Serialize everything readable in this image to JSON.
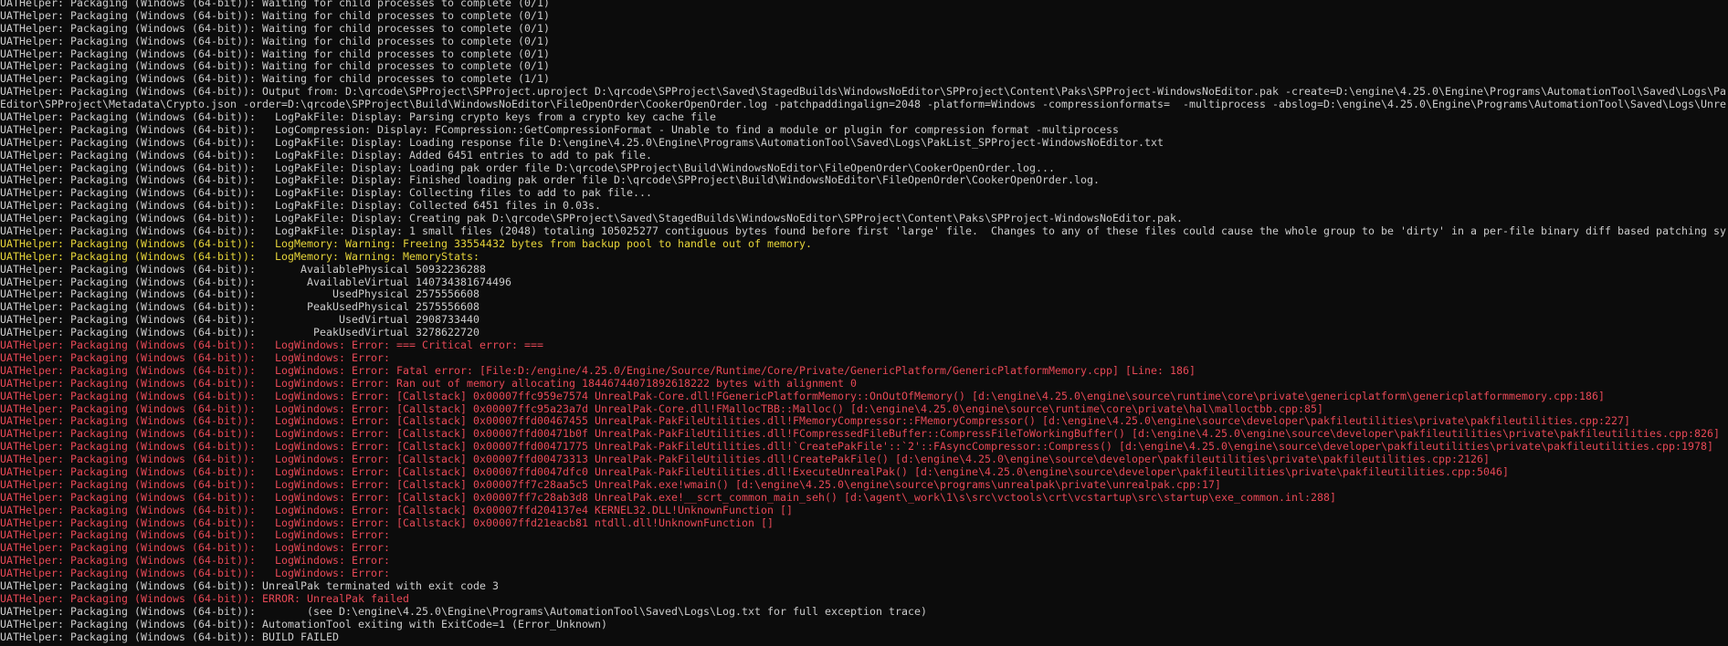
{
  "console": {
    "colors": {
      "background": "#0c0c0c",
      "normal": "#cccccc",
      "warning": "#e6d43a",
      "error": "#e74856"
    },
    "lines": [
      {
        "level": "normal",
        "text": "UATHelper: Packaging (Windows (64-bit)): Waiting for child processes to complete (0/1)"
      },
      {
        "level": "normal",
        "text": "UATHelper: Packaging (Windows (64-bit)): Waiting for child processes to complete (0/1)"
      },
      {
        "level": "normal",
        "text": "UATHelper: Packaging (Windows (64-bit)): Waiting for child processes to complete (0/1)"
      },
      {
        "level": "normal",
        "text": "UATHelper: Packaging (Windows (64-bit)): Waiting for child processes to complete (0/1)"
      },
      {
        "level": "normal",
        "text": "UATHelper: Packaging (Windows (64-bit)): Waiting for child processes to complete (0/1)"
      },
      {
        "level": "normal",
        "text": "UATHelper: Packaging (Windows (64-bit)): Waiting for child processes to complete (0/1)"
      },
      {
        "level": "normal",
        "text": "UATHelper: Packaging (Windows (64-bit)): Waiting for child processes to complete (1/1)"
      },
      {
        "level": "normal",
        "text": "UATHelper: Packaging (Windows (64-bit)): Output from: D:\\qrcode\\SPProject\\SPProject.uproject D:\\qrcode\\SPProject\\Saved\\StagedBuilds\\WindowsNoEditor\\SPProject\\Content\\Paks\\SPProject-WindowsNoEditor.pak -create=D:\\engine\\4.25.0\\Engine\\Programs\\AutomationTool\\Saved\\Logs\\Pa"
      },
      {
        "level": "normal",
        "text": "Editor\\SPProject\\Metadata\\Crypto.json -order=D:\\qrcode\\SPProject\\Build\\WindowsNoEditor\\FileOpenOrder\\CookerOpenOrder.log -patchpaddingalign=2048 -platform=Windows -compressionformats=  -multiprocess -abslog=D:\\engine\\4.25.0\\Engine\\Programs\\AutomationTool\\Saved\\Logs\\Unre"
      },
      {
        "level": "normal",
        "text": "UATHelper: Packaging (Windows (64-bit)):   LogPakFile: Display: Parsing crypto keys from a crypto key cache file"
      },
      {
        "level": "normal",
        "text": "UATHelper: Packaging (Windows (64-bit)):   LogCompression: Display: FCompression::GetCompressionFormat - Unable to find a module or plugin for compression format -multiprocess"
      },
      {
        "level": "normal",
        "text": "UATHelper: Packaging (Windows (64-bit)):   LogPakFile: Display: Loading response file D:\\engine\\4.25.0\\Engine\\Programs\\AutomationTool\\Saved\\Logs\\PakList_SPProject-WindowsNoEditor.txt"
      },
      {
        "level": "normal",
        "text": "UATHelper: Packaging (Windows (64-bit)):   LogPakFile: Display: Added 6451 entries to add to pak file."
      },
      {
        "level": "normal",
        "text": "UATHelper: Packaging (Windows (64-bit)):   LogPakFile: Display: Loading pak order file D:\\qrcode\\SPProject\\Build\\WindowsNoEditor\\FileOpenOrder\\CookerOpenOrder.log..."
      },
      {
        "level": "normal",
        "text": "UATHelper: Packaging (Windows (64-bit)):   LogPakFile: Display: Finished loading pak order file D:\\qrcode\\SPProject\\Build\\WindowsNoEditor\\FileOpenOrder\\CookerOpenOrder.log."
      },
      {
        "level": "normal",
        "text": "UATHelper: Packaging (Windows (64-bit)):   LogPakFile: Display: Collecting files to add to pak file..."
      },
      {
        "level": "normal",
        "text": "UATHelper: Packaging (Windows (64-bit)):   LogPakFile: Display: Collected 6451 files in 0.03s."
      },
      {
        "level": "normal",
        "text": "UATHelper: Packaging (Windows (64-bit)):   LogPakFile: Display: Creating pak D:\\qrcode\\SPProject\\Saved\\StagedBuilds\\WindowsNoEditor\\SPProject\\Content\\Paks\\SPProject-WindowsNoEditor.pak."
      },
      {
        "level": "normal",
        "text": "UATHelper: Packaging (Windows (64-bit)):   LogPakFile: Display: 1 small files (2048) totaling 105025277 contiguous bytes found before first 'large' file.  Changes to any of these files could cause the whole group to be 'dirty' in a per-file binary diff based patching sy"
      },
      {
        "level": "warning",
        "text": "UATHelper: Packaging (Windows (64-bit)):   LogMemory: Warning: Freeing 33554432 bytes from backup pool to handle out of memory."
      },
      {
        "level": "warning",
        "text": "UATHelper: Packaging (Windows (64-bit)):   LogMemory: Warning: MemoryStats:"
      },
      {
        "level": "normal",
        "text": "UATHelper: Packaging (Windows (64-bit)):       AvailablePhysical 50932236288"
      },
      {
        "level": "normal",
        "text": "UATHelper: Packaging (Windows (64-bit)):        AvailableVirtual 140734381674496"
      },
      {
        "level": "normal",
        "text": "UATHelper: Packaging (Windows (64-bit)):            UsedPhysical 2575556608"
      },
      {
        "level": "normal",
        "text": "UATHelper: Packaging (Windows (64-bit)):        PeakUsedPhysical 2575556608"
      },
      {
        "level": "normal",
        "text": "UATHelper: Packaging (Windows (64-bit)):             UsedVirtual 2908733440"
      },
      {
        "level": "normal",
        "text": "UATHelper: Packaging (Windows (64-bit)):         PeakUsedVirtual 3278622720"
      },
      {
        "level": "error",
        "text": "UATHelper: Packaging (Windows (64-bit)):   LogWindows: Error: === Critical error: ==="
      },
      {
        "level": "error",
        "text": "UATHelper: Packaging (Windows (64-bit)):   LogWindows: Error:"
      },
      {
        "level": "error",
        "text": "UATHelper: Packaging (Windows (64-bit)):   LogWindows: Error: Fatal error: [File:D:/engine/4.25.0/Engine/Source/Runtime/Core/Private/GenericPlatform/GenericPlatformMemory.cpp] [Line: 186]"
      },
      {
        "level": "error",
        "text": "UATHelper: Packaging (Windows (64-bit)):   LogWindows: Error: Ran out of memory allocating 18446744071892618222 bytes with alignment 0"
      },
      {
        "level": "error",
        "text": "UATHelper: Packaging (Windows (64-bit)):   LogWindows: Error: [Callstack] 0x00007ffc959e7574 UnrealPak-Core.dll!FGenericPlatformMemory::OnOutOfMemory() [d:\\engine\\4.25.0\\engine\\source\\runtime\\core\\private\\genericplatform\\genericplatformmemory.cpp:186]"
      },
      {
        "level": "error",
        "text": "UATHelper: Packaging (Windows (64-bit)):   LogWindows: Error: [Callstack] 0x00007ffc95a23a7d UnrealPak-Core.dll!FMallocTBB::Malloc() [d:\\engine\\4.25.0\\engine\\source\\runtime\\core\\private\\hal\\malloctbb.cpp:85]"
      },
      {
        "level": "error",
        "text": "UATHelper: Packaging (Windows (64-bit)):   LogWindows: Error: [Callstack] 0x00007ffd00467455 UnrealPak-PakFileUtilities.dll!FMemoryCompressor::FMemoryCompressor() [d:\\engine\\4.25.0\\engine\\source\\developer\\pakfileutilities\\private\\pakfileutilities.cpp:227]"
      },
      {
        "level": "error",
        "text": "UATHelper: Packaging (Windows (64-bit)):   LogWindows: Error: [Callstack] 0x00007ffd00471b0f UnrealPak-PakFileUtilities.dll!FCompressedFileBuffer::CompressFileToWorkingBuffer() [d:\\engine\\4.25.0\\engine\\source\\developer\\pakfileutilities\\private\\pakfileutilities.cpp:826]"
      },
      {
        "level": "error",
        "text": "UATHelper: Packaging (Windows (64-bit)):   LogWindows: Error: [Callstack] 0x00007ffd00471775 UnrealPak-PakFileUtilities.dll!`CreatePakFile'::`2'::FAsyncCompressor::Compress() [d:\\engine\\4.25.0\\engine\\source\\developer\\pakfileutilities\\private\\pakfileutilities.cpp:1978]"
      },
      {
        "level": "error",
        "text": "UATHelper: Packaging (Windows (64-bit)):   LogWindows: Error: [Callstack] 0x00007ffd00473313 UnrealPak-PakFileUtilities.dll!CreatePakFile() [d:\\engine\\4.25.0\\engine\\source\\developer\\pakfileutilities\\private\\pakfileutilities.cpp:2126]"
      },
      {
        "level": "error",
        "text": "UATHelper: Packaging (Windows (64-bit)):   LogWindows: Error: [Callstack] 0x00007ffd0047dfc0 UnrealPak-PakFileUtilities.dll!ExecuteUnrealPak() [d:\\engine\\4.25.0\\engine\\source\\developer\\pakfileutilities\\private\\pakfileutilities.cpp:5046]"
      },
      {
        "level": "error",
        "text": "UATHelper: Packaging (Windows (64-bit)):   LogWindows: Error: [Callstack] 0x00007ff7c28aa5c5 UnrealPak.exe!wmain() [d:\\engine\\4.25.0\\engine\\source\\programs\\unrealpak\\private\\unrealpak.cpp:17]"
      },
      {
        "level": "error",
        "text": "UATHelper: Packaging (Windows (64-bit)):   LogWindows: Error: [Callstack] 0x00007ff7c28ab3d8 UnrealPak.exe!__scrt_common_main_seh() [d:\\agent\\_work\\1\\s\\src\\vctools\\crt\\vcstartup\\src\\startup\\exe_common.inl:288]"
      },
      {
        "level": "error",
        "text": "UATHelper: Packaging (Windows (64-bit)):   LogWindows: Error: [Callstack] 0x00007ffd204137e4 KERNEL32.DLL!UnknownFunction []"
      },
      {
        "level": "error",
        "text": "UATHelper: Packaging (Windows (64-bit)):   LogWindows: Error: [Callstack] 0x00007ffd21eacb81 ntdll.dll!UnknownFunction []"
      },
      {
        "level": "error",
        "text": "UATHelper: Packaging (Windows (64-bit)):   LogWindows: Error:"
      },
      {
        "level": "error",
        "text": "UATHelper: Packaging (Windows (64-bit)):   LogWindows: Error:"
      },
      {
        "level": "error",
        "text": "UATHelper: Packaging (Windows (64-bit)):   LogWindows: Error:"
      },
      {
        "level": "error",
        "text": "UATHelper: Packaging (Windows (64-bit)):   LogWindows: Error:"
      },
      {
        "level": "normal",
        "text": "UATHelper: Packaging (Windows (64-bit)): UnrealPak terminated with exit code 3"
      },
      {
        "level": "error",
        "text": "UATHelper: Packaging (Windows (64-bit)): ERROR: UnrealPak failed"
      },
      {
        "level": "normal",
        "text": "UATHelper: Packaging (Windows (64-bit)):        (see D:\\engine\\4.25.0\\Engine\\Programs\\AutomationTool\\Saved\\Logs\\Log.txt for full exception trace)"
      },
      {
        "level": "normal",
        "text": "UATHelper: Packaging (Windows (64-bit)): AutomationTool exiting with ExitCode=1 (Error_Unknown)"
      },
      {
        "level": "normal",
        "text": "UATHelper: Packaging (Windows (64-bit)): BUILD FAILED"
      }
    ]
  }
}
